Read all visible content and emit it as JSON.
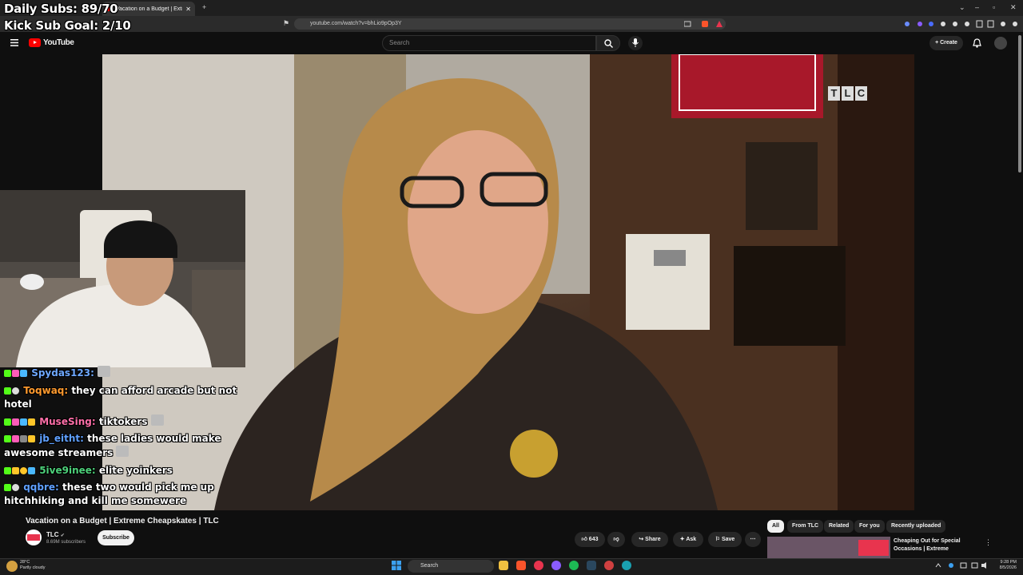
{
  "browser": {
    "tab_title": "Vacation on a Budget | Extreme Cheapskates | TLC",
    "url": "youtube.com/watch?v=bhLio9pOp3Y"
  },
  "stream_overlay": {
    "daily_subs": "Daily Subs: 89/70",
    "kick_goal": "Kick Sub Goal: 2/10"
  },
  "youtube": {
    "logo": "YouTube",
    "search_placeholder": "Search",
    "create_label": "Create",
    "video_watermark": "TLC"
  },
  "chat": [
    {
      "user": "Spydas123:",
      "text": "",
      "color": "#6ea8ff"
    },
    {
      "user": "Toqwaq:",
      "text": "they can afford arcade but not hotel",
      "color": "#ff9a2e"
    },
    {
      "user": "MuseSing:",
      "text": "tiktokers",
      "color": "#ff6fa8"
    },
    {
      "user": "jb_eitht:",
      "text": "these ladies would make awesome streamers",
      "color": "#5fa0ff"
    },
    {
      "user": "5ive9inee:",
      "text": "elite yoinkers",
      "color": "#4dd17a"
    },
    {
      "user": "qqbre:",
      "text": "these two would pick me up hitchhiking and kill me somewere",
      "color": "#5fa0ff"
    }
  ],
  "video_info": {
    "title": "Vacation on a Budget | Extreme Cheapskates | TLC",
    "channel": "TLC",
    "subscribers": "8.69M subscribers",
    "subscribe_label": "Subscribe",
    "likes": "643",
    "share_label": "Share",
    "ask_label": "Ask",
    "save_label": "Save"
  },
  "filter_chips": [
    "All",
    "From TLC",
    "Related",
    "For you",
    "Recently uploaded"
  ],
  "recommendation": {
    "title": "Cheaping Out for Special Occasions | Extreme Cheapskate..."
  },
  "taskbar": {
    "temp": "28°C",
    "weather": "Partly cloudy",
    "search": "Search",
    "time": "9:28 PM",
    "date": "8/5/2026"
  },
  "colors": {
    "youtube_red": "#ff0000",
    "kick_green": "#53fc18"
  }
}
